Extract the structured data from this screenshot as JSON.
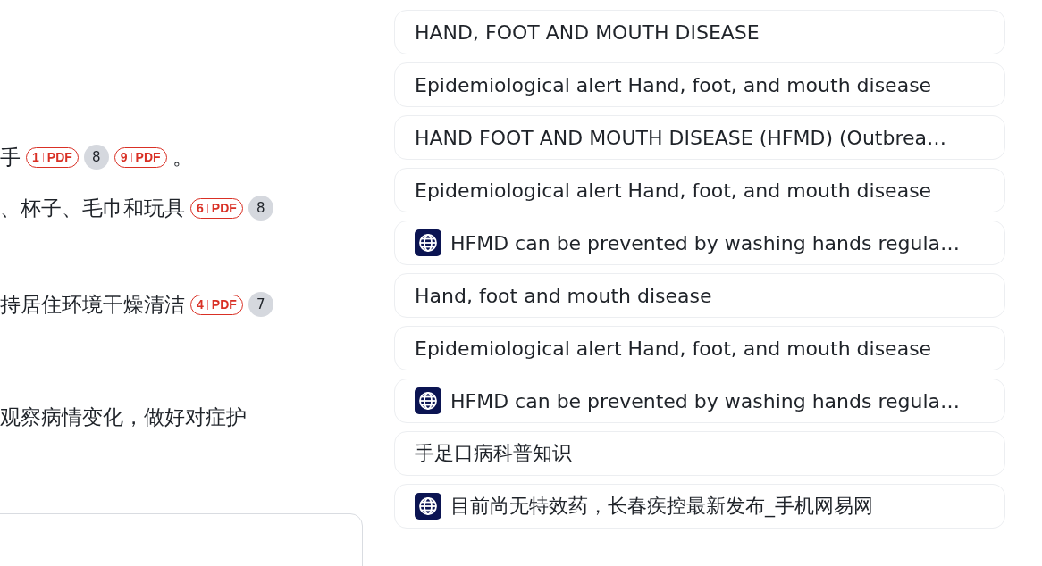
{
  "answer_lines": [
    {
      "segments": [
        {
          "kind": "text",
          "text": "手"
        },
        {
          "kind": "pdf",
          "number": "1",
          "label": "PDF"
        },
        {
          "kind": "count",
          "text": "8"
        },
        {
          "kind": "pdf",
          "number": "9",
          "label": "PDF"
        },
        {
          "kind": "text",
          "text": "。"
        }
      ]
    },
    {
      "segments": [
        {
          "kind": "text",
          "text": "、杯子、毛巾和玩具"
        },
        {
          "kind": "pdf",
          "number": "6",
          "label": "PDF"
        },
        {
          "kind": "count",
          "text": "8"
        }
      ]
    },
    {
      "segments": [
        {
          "kind": "text",
          "text": "持居住环境干燥清洁"
        },
        {
          "kind": "pdf",
          "number": "4",
          "label": "PDF"
        },
        {
          "kind": "count",
          "text": "7"
        }
      ]
    },
    {
      "segments": [
        {
          "kind": "text",
          "text": "观察病情变化，做好对症护"
        }
      ]
    }
  ],
  "sources": [
    {
      "kind": "plain",
      "title": "HAND, FOOT AND MOUTH DISEASE"
    },
    {
      "kind": "plain",
      "title": "Epidemiological alert Hand, foot, and mouth disease"
    },
    {
      "kind": "plain",
      "title": "HAND FOOT AND MOUTH DISEASE (HFMD) (Outbrea…"
    },
    {
      "kind": "plain",
      "title": "Epidemiological alert Hand, foot, and mouth disease"
    },
    {
      "kind": "web",
      "title": "HFMD can be prevented by washing hands regula…"
    },
    {
      "kind": "plain",
      "title": "Hand, foot and mouth disease"
    },
    {
      "kind": "plain",
      "title": "Epidemiological alert Hand, foot, and mouth disease"
    },
    {
      "kind": "web",
      "title": "HFMD can be prevented by washing hands regula…"
    },
    {
      "kind": "plain",
      "title": "手足口病科普知识"
    },
    {
      "kind": "web",
      "title": "目前尚无特效药，长春疾控最新发布_手机网易网"
    }
  ]
}
